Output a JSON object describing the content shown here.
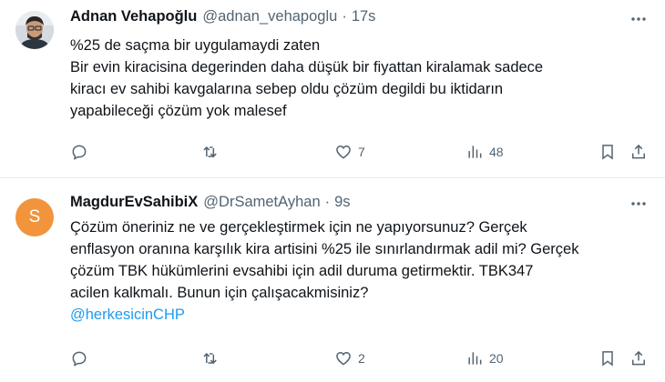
{
  "tweets": [
    {
      "author_name": "Adnan Vehapoğlu",
      "handle": "@adnan_vehapoglu",
      "separator": "·",
      "time": "17s",
      "lines": [
        "%25 de saçma bir uygulamaydi zaten",
        "Bir evin kiracisina degerinden daha düşük bir fiyattan kiralamak sadece",
        "kiracı ev sahibi kavgalarına sebep oldu çözüm degildi bu iktidarın",
        "yapabileceği çözüm yok malesef"
      ],
      "reply_count": "",
      "retweet_count": "",
      "like_count": "7",
      "views_count": "48"
    },
    {
      "author_name": "MagdurEvSahibiX",
      "avatar_letter": "S",
      "avatar_color": "#f1943c",
      "handle": "@DrSametAyhan",
      "separator": "·",
      "time": "9s",
      "lines": [
        "Çözüm öneriniz ne ve gerçekleştirmek için ne yapıyorsunuz? Gerçek",
        "enflasyon oranına karşılık kira artisini %25 ile sınırlandırmak adil mi? Gerçek",
        "çözüm TBK hükümlerini evsahibi için adil duruma getirmektir. TBK347",
        "acilen kalkmalı. Bunun için çalışacakmisiniz?"
      ],
      "mention": "@herkesicinCHP",
      "reply_count": "",
      "retweet_count": "",
      "like_count": "2",
      "views_count": "20"
    }
  ],
  "icons": [
    "reply-icon",
    "retweet-icon",
    "like-icon",
    "views-icon",
    "bookmark-icon",
    "share-icon",
    "more-icon"
  ],
  "colors": {
    "text": "#0f1419",
    "secondary": "#536471",
    "link": "#1d9bf0",
    "divider": "#e6ecf0"
  }
}
